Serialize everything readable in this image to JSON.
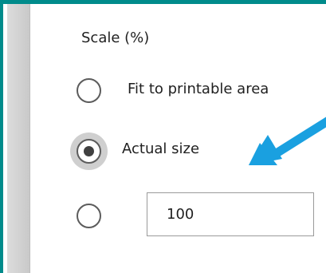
{
  "scale_section": {
    "title": "Scale (%)",
    "options": [
      {
        "label": "Fit to printable area",
        "selected": false
      },
      {
        "label": "Actual size",
        "selected": true
      },
      {
        "label": "",
        "selected": false
      }
    ],
    "custom_value": "100"
  },
  "colors": {
    "frame": "#008b8b",
    "annotation_arrow": "#1aa0e0"
  }
}
